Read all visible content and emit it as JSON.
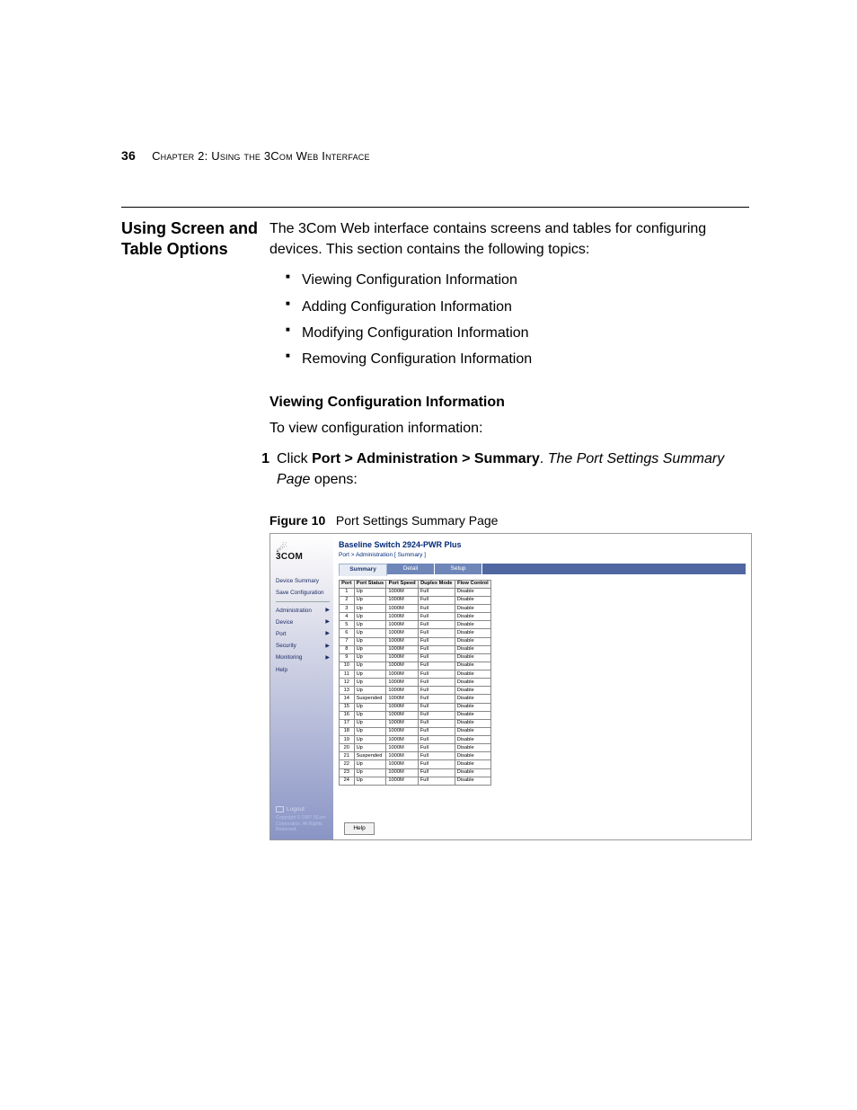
{
  "header": {
    "page_number": "36",
    "chapter_label": "Chapter 2: Using the 3Com Web Interface"
  },
  "section": {
    "side_heading": "Using Screen and Table Options",
    "intro": "The 3Com Web interface contains screens and tables for configuring devices. This section contains the following topics:",
    "bullets": [
      "Viewing Configuration Information",
      "Adding Configuration Information",
      "Modifying Configuration Information",
      "Removing Configuration Information"
    ],
    "sub_heading": "Viewing Configuration Information",
    "sub_intro": "To view configuration information:",
    "step": {
      "num": "1",
      "pre": "Click ",
      "bold_path": "Port > Administration > Summary",
      "mid": ". ",
      "italic_text": "The Port Settings Summary Page",
      "post": " opens:"
    }
  },
  "figure": {
    "label": "Figure 10",
    "caption": "Port Settings Summary Page"
  },
  "screenshot": {
    "logo_text": "3COM",
    "device_title": "Baseline Switch 2924-PWR Plus",
    "breadcrumb": "Port > Administration [ Summary ]",
    "tabs": [
      "Summary",
      "Detail",
      "Setup"
    ],
    "nav_top": [
      "Device Summary",
      "Save Configuration"
    ],
    "nav_main": [
      "Administration",
      "Device",
      "Port",
      "Security",
      "Monitoring",
      "Help"
    ],
    "logout": "Logout",
    "copyright": "Copyright © 2007 3Com Corporation. All Rights Reserved.",
    "table_headers": [
      "Port",
      "Port Status",
      "Port Speed",
      "Duplex Mode",
      "Flow Control"
    ],
    "table_rows": [
      [
        "1",
        "Up",
        "1000M",
        "Full",
        "Disable"
      ],
      [
        "2",
        "Up",
        "1000M",
        "Full",
        "Disable"
      ],
      [
        "3",
        "Up",
        "1000M",
        "Full",
        "Disable"
      ],
      [
        "4",
        "Up",
        "1000M",
        "Full",
        "Disable"
      ],
      [
        "5",
        "Up",
        "1000M",
        "Full",
        "Disable"
      ],
      [
        "6",
        "Up",
        "1000M",
        "Full",
        "Disable"
      ],
      [
        "7",
        "Up",
        "1000M",
        "Full",
        "Disable"
      ],
      [
        "8",
        "Up",
        "1000M",
        "Full",
        "Disable"
      ],
      [
        "9",
        "Up",
        "1000M",
        "Full",
        "Disable"
      ],
      [
        "10",
        "Up",
        "1000M",
        "Full",
        "Disable"
      ],
      [
        "11",
        "Up",
        "1000M",
        "Full",
        "Disable"
      ],
      [
        "12",
        "Up",
        "1000M",
        "Full",
        "Disable"
      ],
      [
        "13",
        "Up",
        "1000M",
        "Full",
        "Disable"
      ],
      [
        "14",
        "Suspended",
        "1000M",
        "Full",
        "Disable"
      ],
      [
        "15",
        "Up",
        "1000M",
        "Full",
        "Disable"
      ],
      [
        "16",
        "Up",
        "1000M",
        "Full",
        "Disable"
      ],
      [
        "17",
        "Up",
        "1000M",
        "Full",
        "Disable"
      ],
      [
        "18",
        "Up",
        "1000M",
        "Full",
        "Disable"
      ],
      [
        "19",
        "Up",
        "1000M",
        "Full",
        "Disable"
      ],
      [
        "20",
        "Up",
        "1000M",
        "Full",
        "Disable"
      ],
      [
        "21",
        "Suspended",
        "1000M",
        "Full",
        "Disable"
      ],
      [
        "22",
        "Up",
        "1000M",
        "Full",
        "Disable"
      ],
      [
        "23",
        "Up",
        "1000M",
        "Full",
        "Disable"
      ],
      [
        "24",
        "Up",
        "1000M",
        "Full",
        "Disable"
      ]
    ],
    "help_button": "Help"
  }
}
